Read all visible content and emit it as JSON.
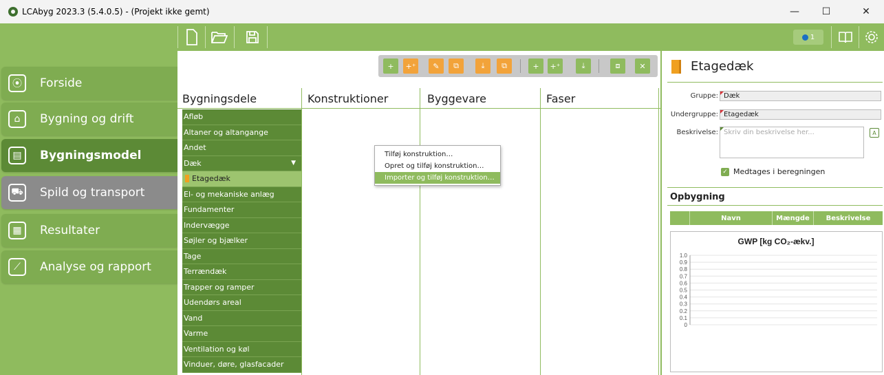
{
  "window": {
    "title": "LCAbyg 2023.3 (5.4.0.5) - (Projekt ikke gemt)",
    "minimize": "—",
    "maximize": "☐",
    "close": "✕"
  },
  "toolbar": {
    "icons": [
      "new-file-icon",
      "open-folder-icon",
      "save-icon"
    ],
    "notification_count": "1",
    "right_icons": [
      "book-icon",
      "gear-icon"
    ]
  },
  "sidebar": {
    "items": [
      {
        "label": "Forside",
        "icon": "⦿"
      },
      {
        "label": "Bygning og drift",
        "icon": "⌂"
      },
      {
        "label": "Bygningsmodel",
        "icon": "▤"
      },
      {
        "label": "Spild og transport",
        "icon": "⛟"
      },
      {
        "label": "Resultater",
        "icon": "▦"
      },
      {
        "label": "Analyse og rapport",
        "icon": "⟋"
      }
    ]
  },
  "action_toolbar": {
    "buttons": [
      "+",
      "+⁺",
      "✎",
      "⧉",
      "⤓",
      "⧉",
      "+",
      "+⁺",
      "⤓",
      "⧈",
      "✕"
    ]
  },
  "columns": {
    "bygningsdele": "Bygningsdele",
    "konstruktioner": "Konstruktioner",
    "byggevare": "Byggevare",
    "faser": "Faser"
  },
  "bygningsdele": [
    "Afløb",
    "Altaner og altangange",
    "Andet",
    "Dæk",
    "Etagedæk",
    "El- og mekaniske anlæg",
    "Fundamenter",
    "Indervægge",
    "Søjler og bjælker",
    "Tage",
    "Terrændæk",
    "Trapper og ramper",
    "Udendørs areal",
    "Vand",
    "Varme",
    "Ventilation og køl",
    "Vinduer, døre, glasfacader"
  ],
  "context_menu": {
    "items": [
      "Tilføj konstruktion…",
      "Opret og tilføj konstruktion…",
      "Importer og tilføj konstruktion…"
    ]
  },
  "right_panel": {
    "title": "Etagedæk",
    "gruppe_label": "Gruppe:",
    "gruppe_value": "Dæk",
    "undergruppe_label": "Undergruppe:",
    "undergruppe_value": "Etagedæk",
    "beskrivelse_label": "Beskrivelse:",
    "beskrivelse_placeholder": "Skriv din beskrivelse her...",
    "medtages_label": "Medtages i beregningen",
    "opbygning_title": "Opbygning",
    "table_headers": [
      "",
      "Navn",
      "Mængde",
      "Beskrivelse"
    ]
  },
  "chart_data": {
    "type": "bar",
    "title": "GWP [kg CO₂-ækv.]",
    "categories": [],
    "values": [],
    "yticks": [
      "1.0",
      "0.9",
      "0.8",
      "0.7",
      "0.6",
      "0.5",
      "0.4",
      "0.3",
      "0.2",
      "0.1",
      "0"
    ],
    "ylim": [
      0,
      1.0
    ],
    "grid": true
  }
}
